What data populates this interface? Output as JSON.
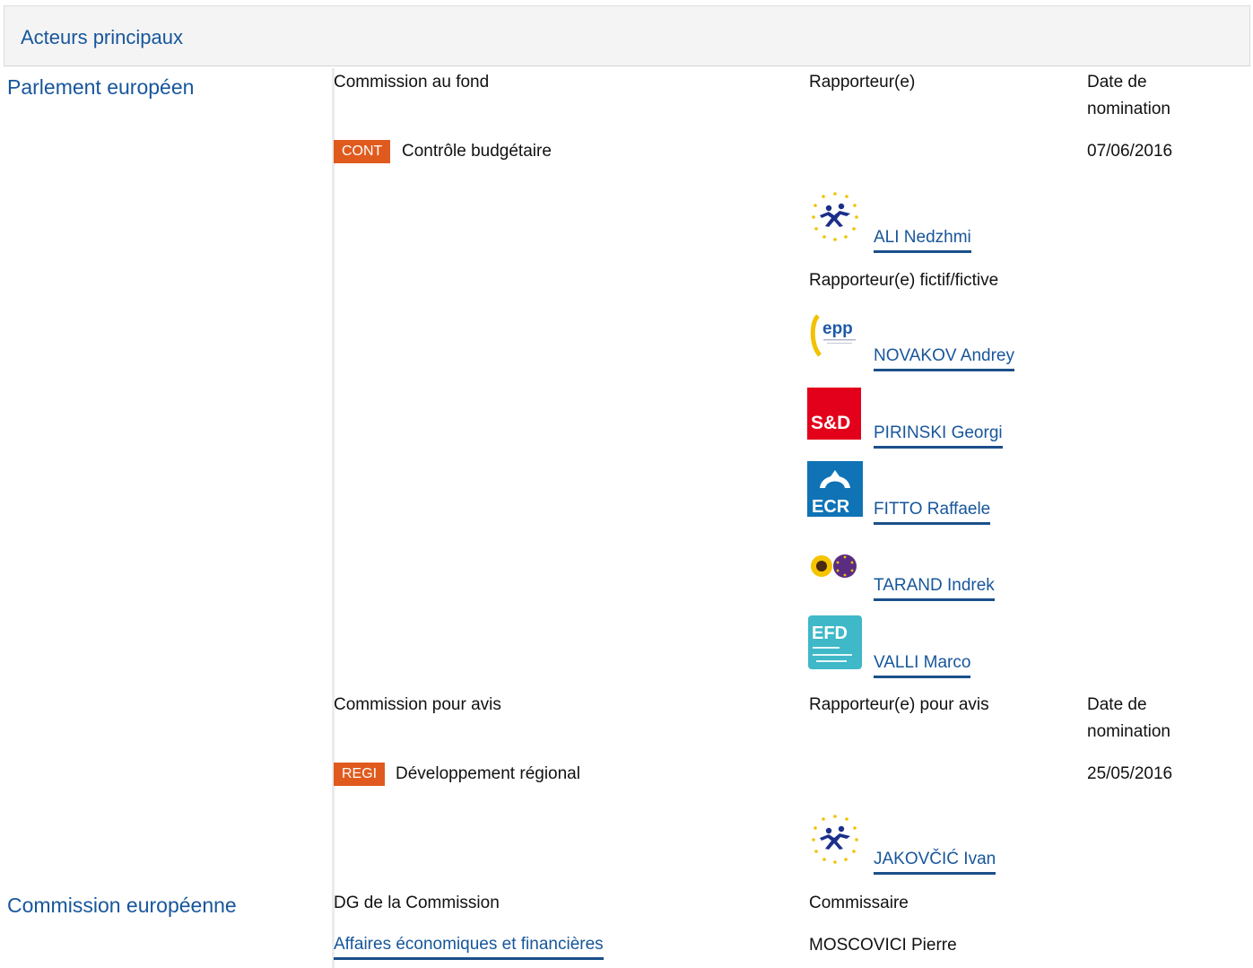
{
  "page": {
    "title": "Acteurs principaux"
  },
  "parlement": {
    "label": "Parlement européen",
    "fond": {
      "col_commission": "Commission au fond",
      "col_rapporteur": "Rapporteur(e)",
      "col_date": "Date de nomination",
      "committee_code": "CONT",
      "committee_name": "Contrôle budgétaire",
      "date": "07/06/2016",
      "rapporteur": {
        "name": "ALI Nedzhmi",
        "group_icon": "alde-logo"
      },
      "shadow_label": "Rapporteur(e) fictif/fictive",
      "shadows": [
        {
          "name": "NOVAKOV Andrey",
          "group_icon": "epp-logo"
        },
        {
          "name": "PIRINSKI Georgi",
          "group_icon": "s-and-d-logo",
          "logo_text": "S&D"
        },
        {
          "name": "FITTO Raffaele",
          "group_icon": "ecr-logo",
          "logo_text": "ECR"
        },
        {
          "name": "TARAND Indrek",
          "group_icon": "greens-efa-logo"
        },
        {
          "name": "VALLI Marco",
          "group_icon": "efdd-logo",
          "logo_text": "EFD"
        }
      ]
    },
    "avis": {
      "col_commission": "Commission pour avis",
      "col_rapporteur": "Rapporteur(e) pour avis",
      "col_date": "Date de nomination",
      "committee_code": "REGI",
      "committee_name": "Développement régional",
      "date": "25/05/2016",
      "rapporteur": {
        "name": "JAKOVČIĆ Ivan",
        "group_icon": "alde-logo"
      }
    }
  },
  "commission": {
    "label": "Commission européenne",
    "col_dg": "DG de la Commission",
    "col_commissaire": "Commissaire",
    "dg_name": "Affaires économiques et financières",
    "commissaire": "MOSCOVICI Pierre"
  },
  "colors": {
    "link": "#17569b",
    "badge": "#e05a1e",
    "header_bg": "#f4f4f4",
    "sd_red": "#e2001a",
    "ecr_blue": "#0f73b6",
    "efd_teal": "#3fb8c8"
  }
}
